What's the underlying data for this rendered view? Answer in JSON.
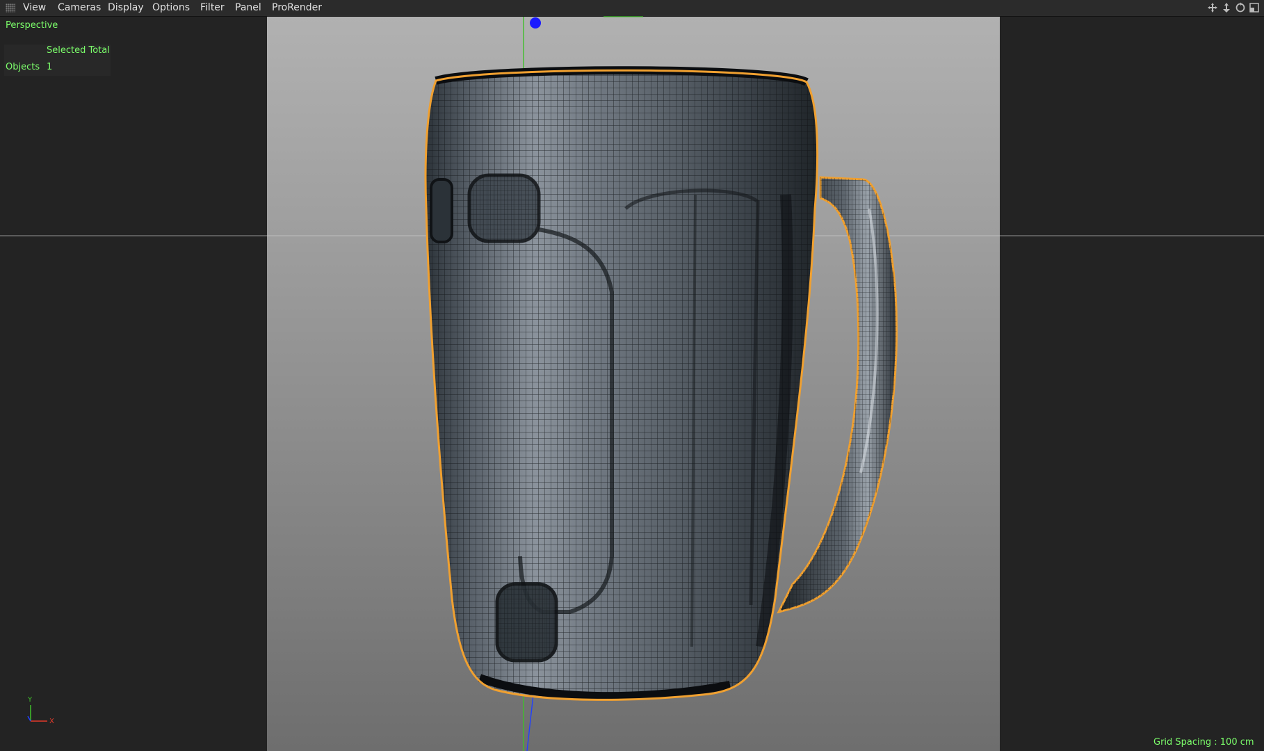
{
  "menubar": {
    "items": [
      "View",
      "Cameras",
      "Display",
      "Options",
      "Filter",
      "Panel",
      "ProRender"
    ]
  },
  "viewport": {
    "camera_label": "Perspective",
    "stats": {
      "header": "Selected Total",
      "row_label": "Objects",
      "row_value": "1"
    },
    "axis": {
      "y_label": "Y",
      "x_label": "X"
    },
    "grid_spacing": "Grid Spacing : 100 cm"
  },
  "icons": {
    "menu_grip": "grip-icon",
    "nav": [
      "move-view-icon",
      "zoom-view-icon",
      "rotate-view-icon",
      "toggle-panel-icon"
    ]
  },
  "colors": {
    "hud_text": "#7cff6b",
    "selection_outline": "#f0a030",
    "axis_y": "#3fbf2a",
    "axis_x": "#e33b2b",
    "axis_z": "#2040ff"
  }
}
